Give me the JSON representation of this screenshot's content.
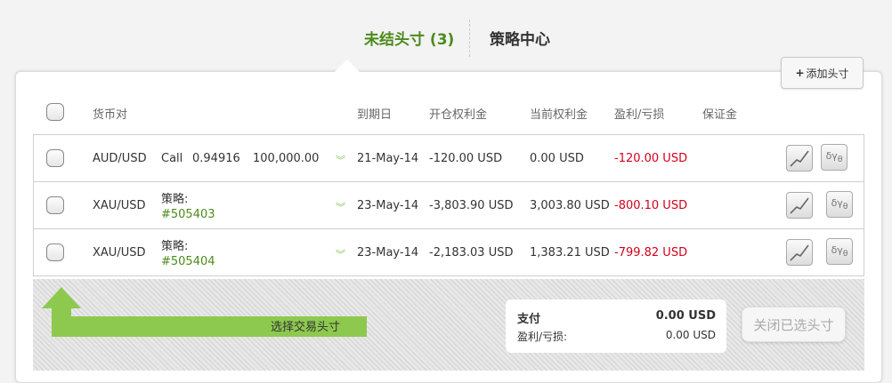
{
  "tabs": {
    "open_positions": "未结头寸 (3)",
    "strategy_center": "策略中心"
  },
  "add_position_label": "添加头寸",
  "columns": {
    "pair": "货币对",
    "expiry": "到期日",
    "open_premium": "开仓权利金",
    "current_premium": "当前权利金",
    "pnl": "盈利/亏损",
    "margin": "保证金"
  },
  "rows": [
    {
      "pair": "AUD/USD",
      "type": "Call",
      "strike": "0.94916",
      "amount": "100,000.00",
      "expiry": "21-May-14",
      "open_premium": "-120.00 USD",
      "current_premium": "0.00 USD",
      "pnl": "-120.00 USD"
    },
    {
      "pair": "XAU/USD",
      "strategy_label": "策略:",
      "strategy_id": "#505403",
      "expiry": "23-May-14",
      "open_premium": "-3,803.90 USD",
      "current_premium": "3,003.80 USD",
      "pnl": "-800.10 USD"
    },
    {
      "pair": "XAU/USD",
      "strategy_label": "策略:",
      "strategy_id": "#505404",
      "expiry": "23-May-14",
      "open_premium": "-2,183.03 USD",
      "current_premium": "1,383.21 USD",
      "pnl": "-799.82 USD"
    }
  ],
  "footer": {
    "select_hint": "选择交易头寸",
    "payment_label": "支付",
    "payment_value": "0.00 USD",
    "pnl_label": "盈利/亏损:",
    "pnl_value": "0.00 USD",
    "close_selected": "关闭已选头寸"
  },
  "icons": {
    "chart": "line-chart-icon",
    "greeks": "greeks-icon"
  },
  "colors": {
    "accent": "#4c8a1c",
    "loss": "#d0021b",
    "arrow": "#8dc94f"
  }
}
